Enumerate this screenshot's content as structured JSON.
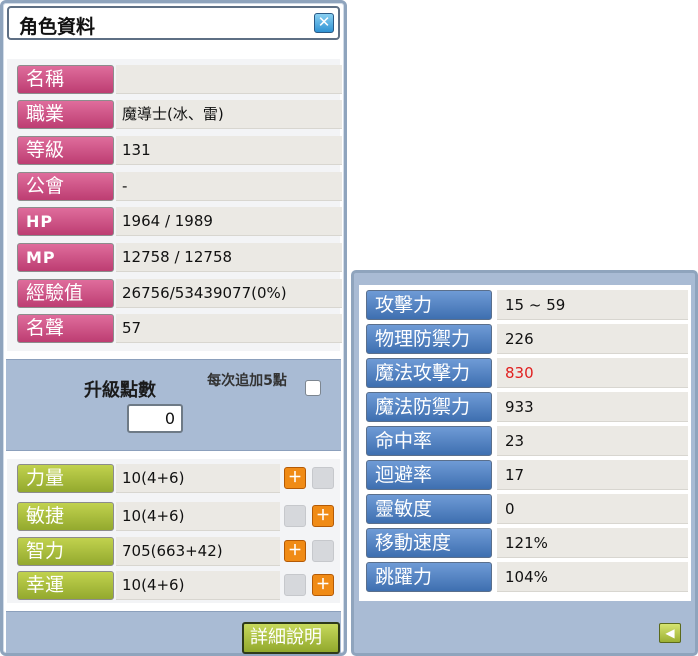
{
  "window": {
    "title": "角色資料",
    "close_label": "✕"
  },
  "profile": [
    {
      "label": "名稱",
      "value": ""
    },
    {
      "label": "職業",
      "value": "魔導士(冰、雷)"
    },
    {
      "label": "等級",
      "value": "131"
    },
    {
      "label": "公會",
      "value": "-"
    },
    {
      "label": "HP",
      "value": "1964 / 1989"
    },
    {
      "label": "MP",
      "value": "12758 / 12758"
    },
    {
      "label": "經驗值",
      "value": "26756/53439077(0%)"
    },
    {
      "label": "名聲",
      "value": "57"
    }
  ],
  "points": {
    "label": "升級點數",
    "value": "0",
    "add5_label": "每次追加5點"
  },
  "stats": [
    {
      "label": "力量",
      "value": "10(4+6)",
      "add_enabled": true
    },
    {
      "label": "敏捷",
      "value": "10(4+6)",
      "add_enabled": true
    },
    {
      "label": "智力",
      "value": "705(663+42)",
      "add_enabled": true
    },
    {
      "label": "幸運",
      "value": "10(4+6)",
      "add_enabled": true
    }
  ],
  "detail_button": "詳細說明",
  "detail_stats": [
    {
      "label": "攻擊力",
      "value": "15 ~ 59"
    },
    {
      "label": "物理防禦力",
      "value": "226"
    },
    {
      "label": "魔法攻擊力",
      "value": "830",
      "highlight_color": "#e02020"
    },
    {
      "label": "魔法防禦力",
      "value": "933"
    },
    {
      "label": "命中率",
      "value": "23"
    },
    {
      "label": "迴避率",
      "value": "17"
    },
    {
      "label": "靈敏度",
      "value": "0"
    },
    {
      "label": "移動速度",
      "value": "121%"
    },
    {
      "label": "跳躍力",
      "value": "104%"
    }
  ],
  "icons": {
    "close": "close-icon",
    "add": "plus-icon",
    "back": "arrow-left-icon"
  },
  "colors": {
    "profile_label": "#cf5187",
    "stat_label": "#a8bc3c",
    "detail_label": "#4f82c4",
    "panel_bg": "#a9bbd4"
  }
}
